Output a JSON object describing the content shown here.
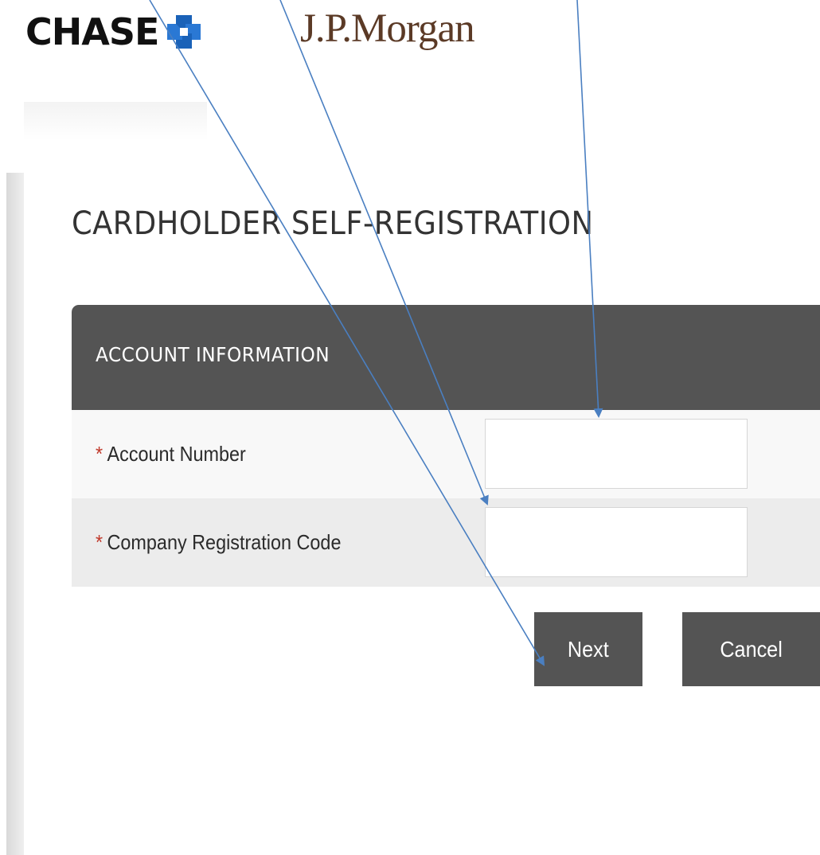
{
  "header": {
    "chase_logo_text": "CHASE",
    "jpmorgan_logo_text": "J.P.Morgan"
  },
  "page": {
    "title": "CARDHOLDER SELF-REGISTRATION"
  },
  "section": {
    "title": "ACCOUNT INFORMATION",
    "fields": [
      {
        "required_mark": "*",
        "label": "Account Number",
        "value": ""
      },
      {
        "required_mark": "*",
        "label": "Company Registration Code",
        "value": ""
      }
    ]
  },
  "buttons": {
    "next_label": "Next",
    "cancel_label": "Cancel"
  },
  "colors": {
    "section_header_bg": "#545454",
    "button_bg": "#545454",
    "required_mark": "#c0392b",
    "jpmorgan_brand": "#5b3a26",
    "chase_blue": "#1a62b8",
    "annotation_arrow": "#4a7fc1"
  },
  "icons": {
    "chase_logo": "chase-octagon-icon"
  }
}
